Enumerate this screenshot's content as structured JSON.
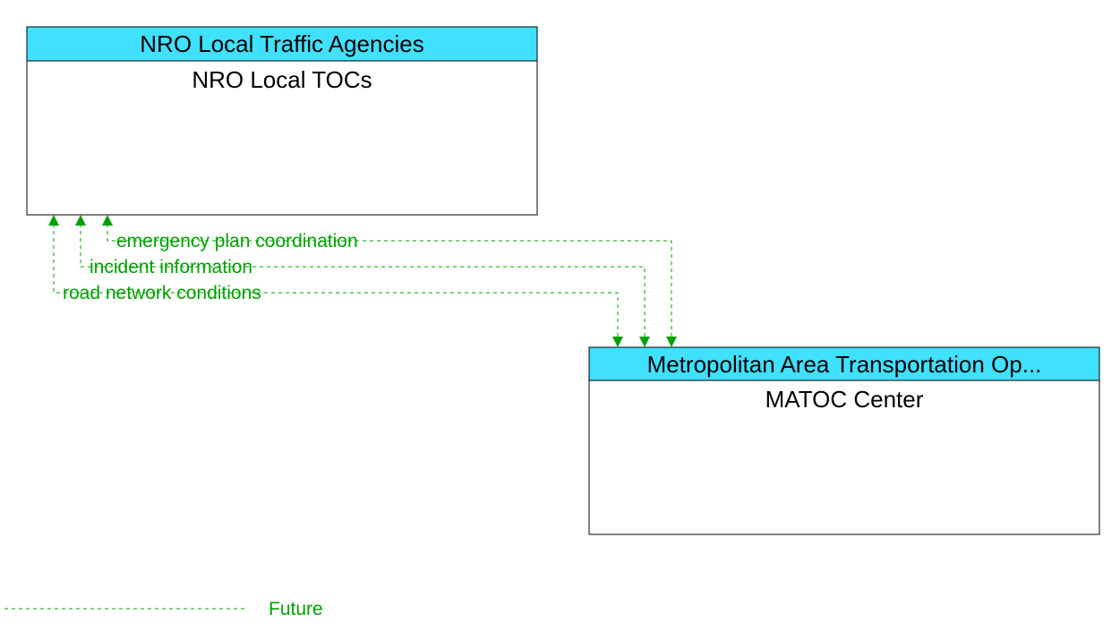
{
  "colors": {
    "header_fill": "#40e0ff",
    "line_color": "#00a000"
  },
  "nodes": {
    "top": {
      "header": "NRO Local Traffic Agencies",
      "body": "NRO Local TOCs"
    },
    "bottom": {
      "header": "Metropolitan Area Transportation Op...",
      "body": "MATOC Center"
    }
  },
  "flows": [
    {
      "label": "emergency plan coordination"
    },
    {
      "label": "incident information"
    },
    {
      "label": "road network conditions"
    }
  ],
  "legend": {
    "label": "Future"
  }
}
